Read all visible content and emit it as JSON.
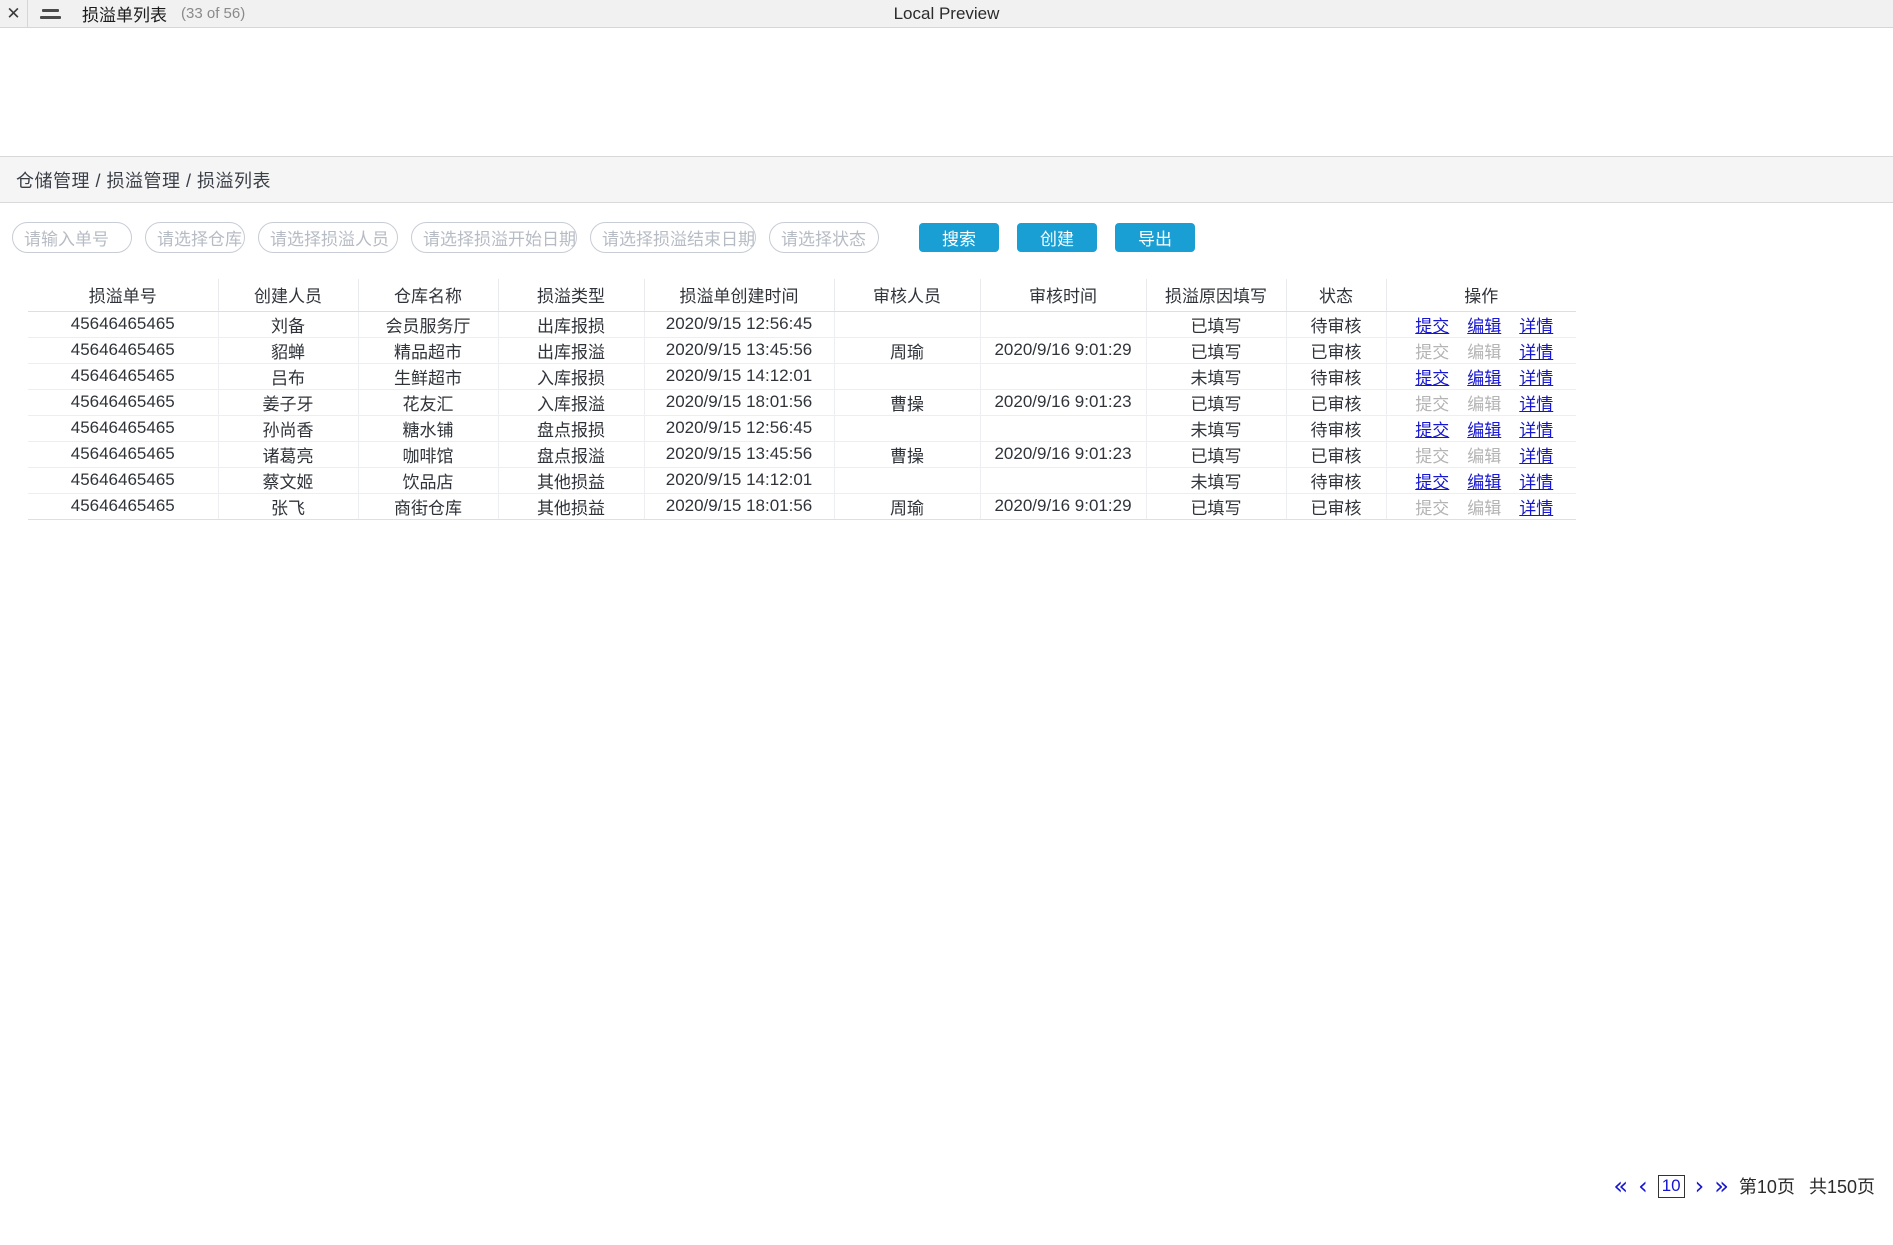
{
  "window": {
    "close_icon": "close-icon",
    "menu_icon": "hamburger-menu-icon",
    "title": "损溢单列表",
    "count": "(33 of 56)",
    "center_label": "Local Preview"
  },
  "breadcrumb": {
    "text": "仓储管理 / 损溢管理 / 损溢列表"
  },
  "toolbar": {
    "order_no_placeholder": "请输入单号",
    "warehouse_placeholder": "请选择仓库",
    "person_placeholder": "请选择损溢人员",
    "date_start_placeholder": "请选择损溢开始日期",
    "date_end_placeholder": "请选择损溢结束日期",
    "status_placeholder": "请选择状态",
    "search_label": "搜索",
    "create_label": "创建",
    "export_label": "导出",
    "accent_color": "#1a9fd4"
  },
  "table": {
    "headers": [
      "损溢单号",
      "创建人员",
      "仓库名称",
      "损溢类型",
      "损溢单创建时间",
      "审核人员",
      "审核时间",
      "损溢原因填写",
      "状态",
      "操作"
    ],
    "action_labels": {
      "submit": "提交",
      "edit": "编辑",
      "detail": "详情"
    },
    "rows": [
      {
        "order_no": "45646465465",
        "creator": "刘备",
        "warehouse": "会员服务厅",
        "type": "出库报损",
        "created_at": "2020/9/15 12:56:45",
        "auditor": "",
        "audited_at": "",
        "reason_filled": "已填写",
        "status": "待审核",
        "submit_enabled": true,
        "edit_enabled": true,
        "detail_enabled": true
      },
      {
        "order_no": "45646465465",
        "creator": "貂蝉",
        "warehouse": "精品超市",
        "type": "出库报溢",
        "created_at": "2020/9/15 13:45:56",
        "auditor": "周瑜",
        "audited_at": "2020/9/16 9:01:29",
        "reason_filled": "已填写",
        "status": "已审核",
        "submit_enabled": false,
        "edit_enabled": false,
        "detail_enabled": true
      },
      {
        "order_no": "45646465465",
        "creator": "吕布",
        "warehouse": "生鲜超市",
        "type": "入库报损",
        "created_at": "2020/9/15 14:12:01",
        "auditor": "",
        "audited_at": "",
        "reason_filled": "未填写",
        "status": "待审核",
        "submit_enabled": true,
        "edit_enabled": true,
        "detail_enabled": true
      },
      {
        "order_no": "45646465465",
        "creator": "姜子牙",
        "warehouse": "花友汇",
        "type": "入库报溢",
        "created_at": "2020/9/15 18:01:56",
        "auditor": "曹操",
        "audited_at": "2020/9/16 9:01:23",
        "reason_filled": "已填写",
        "status": "已审核",
        "submit_enabled": false,
        "edit_enabled": false,
        "detail_enabled": true
      },
      {
        "order_no": "45646465465",
        "creator": "孙尚香",
        "warehouse": "糖水铺",
        "type": "盘点报损",
        "created_at": "2020/9/15 12:56:45",
        "auditor": "",
        "audited_at": "",
        "reason_filled": "未填写",
        "status": "待审核",
        "submit_enabled": true,
        "edit_enabled": true,
        "detail_enabled": true
      },
      {
        "order_no": "45646465465",
        "creator": "诸葛亮",
        "warehouse": "咖啡馆",
        "type": "盘点报溢",
        "created_at": "2020/9/15 13:45:56",
        "auditor": "曹操",
        "audited_at": "2020/9/16 9:01:23",
        "reason_filled": "已填写",
        "status": "已审核",
        "submit_enabled": false,
        "edit_enabled": false,
        "detail_enabled": true
      },
      {
        "order_no": "45646465465",
        "creator": "蔡文姬",
        "warehouse": "饮品店",
        "type": "其他损益",
        "created_at": "2020/9/15 14:12:01",
        "auditor": "",
        "audited_at": "",
        "reason_filled": "未填写",
        "status": "待审核",
        "submit_enabled": true,
        "edit_enabled": true,
        "detail_enabled": true
      },
      {
        "order_no": "45646465465",
        "creator": "张飞",
        "warehouse": "商街仓库",
        "type": "其他损益",
        "created_at": "2020/9/15 18:01:56",
        "auditor": "周瑜",
        "audited_at": "2020/9/16 9:01:29",
        "reason_filled": "已填写",
        "status": "已审核",
        "submit_enabled": false,
        "edit_enabled": false,
        "detail_enabled": true
      }
    ]
  },
  "pagination": {
    "first": "«",
    "prev": "‹",
    "current_page": "10",
    "next": "›",
    "last": "»",
    "page_label": "第10页",
    "total_label": "共150页"
  }
}
